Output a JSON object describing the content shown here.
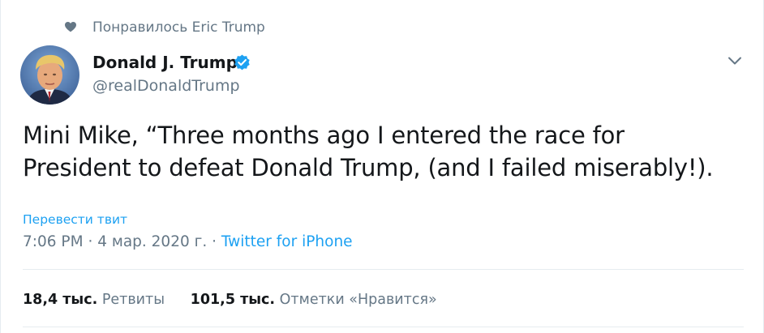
{
  "social_context": {
    "text": "Понравилось Eric Trump",
    "icon": "heart-icon"
  },
  "author": {
    "name": "Donald J. Trump",
    "handle": "@realDonaldTrump",
    "verified": true,
    "verified_icon": "verified-badge-icon"
  },
  "tweet": {
    "text": "Mini Mike, “Three months ago I entered the race for\nPresident to defeat Donald Trump, (and I failed miserably!).",
    "translate_label": "Перевести твит",
    "time": "7:06 PM",
    "date": "4 мар. 2020 г.",
    "separator": "·",
    "source": "Twitter for iPhone"
  },
  "stats": {
    "retweets_count": "18,4 тыс.",
    "retweets_label": "Ретвиты",
    "likes_count": "101,5 тыс.",
    "likes_label": "Отметки «Нравится»"
  },
  "colors": {
    "accent": "#1da1f2",
    "secondary_text": "#657786",
    "primary_text": "#14171a",
    "divider": "#e6ecf0"
  }
}
